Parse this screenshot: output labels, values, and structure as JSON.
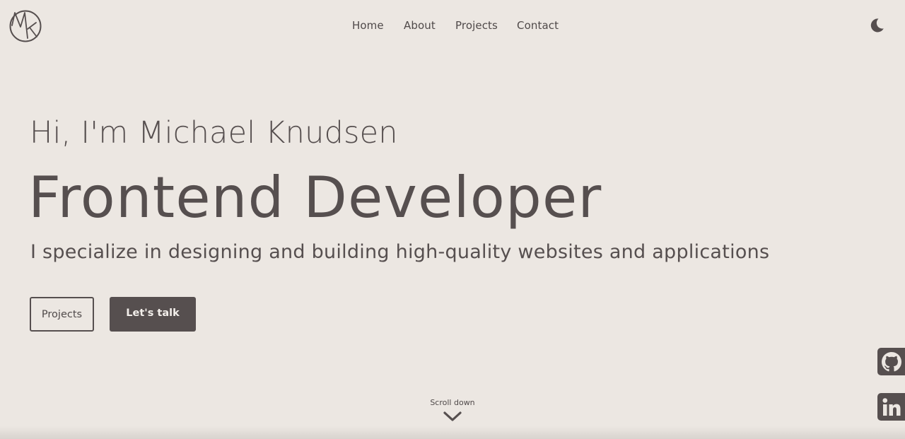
{
  "header": {
    "logo_text": "MK",
    "nav": [
      {
        "label": "Home"
      },
      {
        "label": "About"
      },
      {
        "label": "Projects"
      },
      {
        "label": "Contact"
      }
    ],
    "theme_toggle_icon": "moon-icon"
  },
  "hero": {
    "greeting": "Hi, I'm Michael Knudsen",
    "role": "Frontend Developer",
    "tagline": "I specialize in designing and building high-quality websites and applications",
    "buttons": {
      "projects_label": "Projects",
      "talk_label": "Let's talk"
    }
  },
  "scroll": {
    "label": "Scroll down",
    "icon": "chevron-down-icon"
  },
  "social": {
    "github_icon": "github-icon",
    "linkedin_icon": "linkedin-icon"
  },
  "colors": {
    "background": "#ece7e2",
    "text": "#564f4f",
    "button_dark": "#564f4f",
    "button_text_light": "#f3efeb"
  }
}
